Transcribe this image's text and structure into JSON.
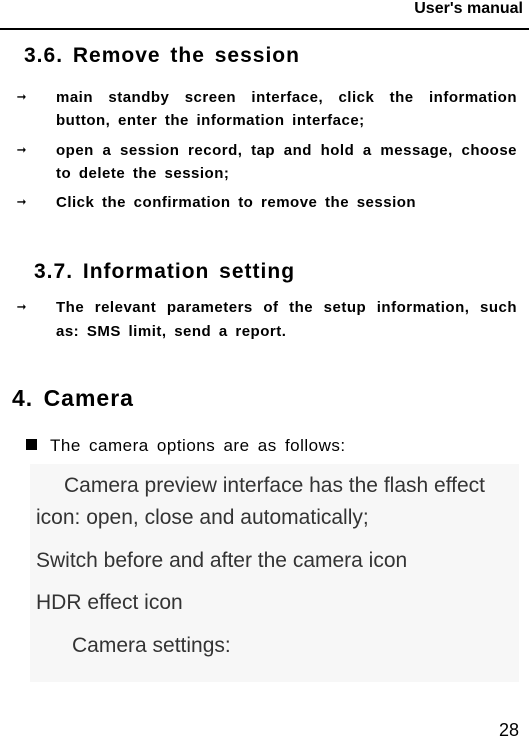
{
  "header": {
    "title": "User's manual"
  },
  "sections": {
    "s36": {
      "heading": "3.6. Remove the session",
      "items": [
        "main standby screen interface, click the information button, enter the information interface;",
        "open a session record, tap and hold a message, choose to delete the session;",
        "Click the confirmation to remove the session"
      ]
    },
    "s37": {
      "heading": "3.7. Information setting",
      "items": [
        "The relevant parameters of the setup information, such as: SMS limit, send a report."
      ]
    },
    "s4": {
      "heading": "4. Camera",
      "intro": "The camera options are as follows:",
      "block": {
        "p1": "Camera preview interface has the flash effect icon: open, close and automatically;",
        "p2": "Switch before and after the camera icon",
        "p3": "HDR effect icon",
        "p4": "Camera settings:"
      }
    }
  },
  "page_number": "28"
}
